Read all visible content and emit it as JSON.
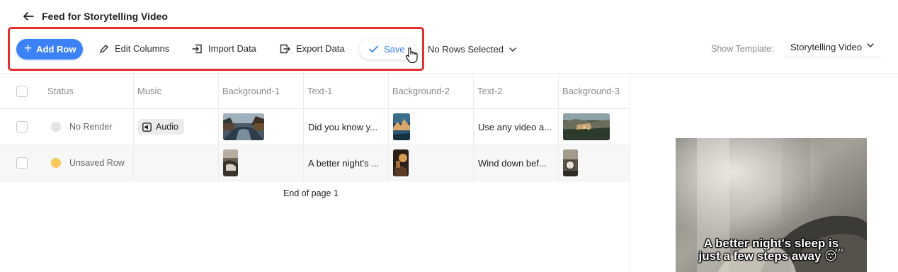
{
  "header": {
    "title": "Feed for Storytelling Video"
  },
  "toolbar": {
    "add_row": "Add Row",
    "edit_columns": "Edit Columns",
    "import_data": "Import Data",
    "export_data": "Export Data",
    "save": "Save",
    "rows_selected": "No Rows Selected",
    "show_template_label": "Show Template:",
    "template_value": "Storytelling Video"
  },
  "table": {
    "columns": [
      "Status",
      "Music",
      "Background-1",
      "Text-1",
      "Background-2",
      "Text-2",
      "Background-3"
    ],
    "rows": [
      {
        "status": "No Render",
        "status_color": "#e3e3e3",
        "music": "Audio",
        "text1": "Did you know y...",
        "text2": "Use any video a..."
      },
      {
        "status": "Unsaved Row",
        "status_color": "#f9c85a",
        "music": "",
        "text1": "A better night's ...",
        "text2": "Wind down bef..."
      }
    ],
    "end_of_page": "End of page 1"
  },
  "preview": {
    "caption_line1": "A better night's sleep is",
    "caption_line2": "just a few steps away 😴"
  },
  "colors": {
    "accent": "#3b82f6",
    "highlight": "#e0312f"
  },
  "icons": [
    "back-arrow-icon",
    "plus-icon",
    "pencil-icon",
    "import-icon",
    "export-icon",
    "check-icon",
    "chevron-down-icon",
    "audio-icon",
    "hand-cursor-icon"
  ]
}
